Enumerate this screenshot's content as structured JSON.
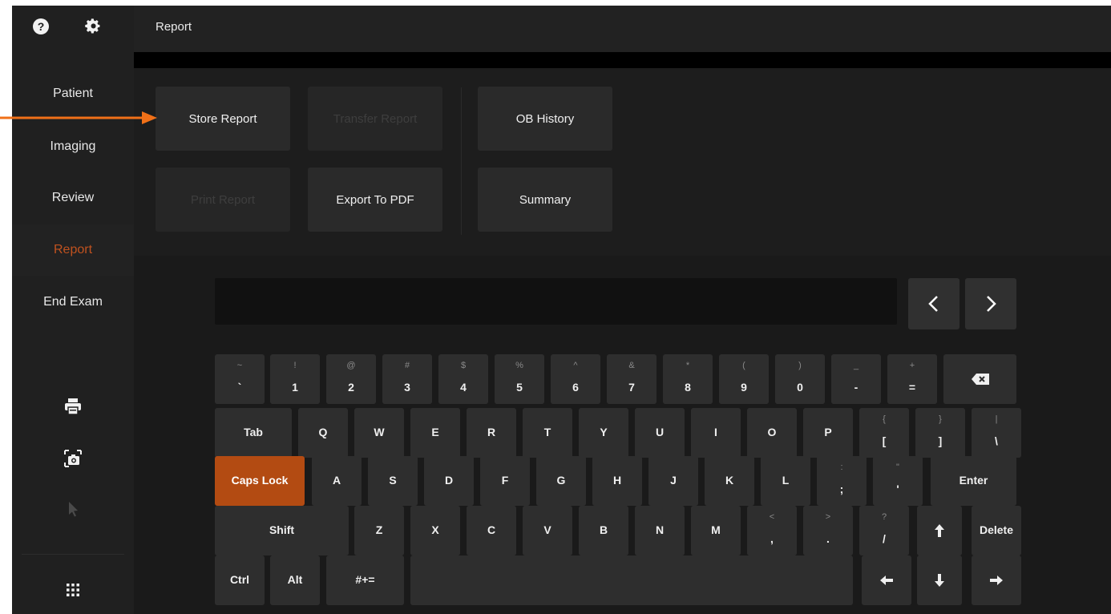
{
  "header": {
    "title": "Report"
  },
  "sidebar": {
    "items": [
      {
        "label": "Patient"
      },
      {
        "label": "Imaging"
      },
      {
        "label": "Review"
      },
      {
        "label": "Report",
        "active": true
      },
      {
        "label": "End Exam"
      }
    ],
    "icons": [
      "help-icon",
      "gear-icon",
      "print-icon",
      "camera-icon",
      "pointer-icon",
      "apps-grid-icon"
    ]
  },
  "report_buttons": {
    "store": "Store Report",
    "transfer": "Transfer Report",
    "ob_history": "OB History",
    "print": "Print Report",
    "export_pdf": "Export To PDF",
    "summary": "Summary"
  },
  "keyboard": {
    "row1": [
      {
        "shift": "~",
        "base": "`"
      },
      {
        "shift": "!",
        "base": "1"
      },
      {
        "shift": "@",
        "base": "2"
      },
      {
        "shift": "#",
        "base": "3"
      },
      {
        "shift": "$",
        "base": "4"
      },
      {
        "shift": "%",
        "base": "5"
      },
      {
        "shift": "^",
        "base": "6"
      },
      {
        "shift": "&",
        "base": "7"
      },
      {
        "shift": "*",
        "base": "8"
      },
      {
        "shift": "(",
        "base": "9"
      },
      {
        "shift": ")",
        "base": "0"
      },
      {
        "shift": "_",
        "base": "-"
      },
      {
        "shift": "+",
        "base": "="
      }
    ],
    "tab": "Tab",
    "row2": [
      "Q",
      "W",
      "E",
      "R",
      "T",
      "Y",
      "U",
      "I",
      "O",
      "P"
    ],
    "row2_sym": [
      {
        "shift": "{",
        "base": "["
      },
      {
        "shift": "}",
        "base": "]"
      },
      {
        "shift": "|",
        "base": "\\"
      }
    ],
    "caps": "Caps Lock",
    "row3": [
      "A",
      "S",
      "D",
      "F",
      "G",
      "H",
      "J",
      "K",
      "L"
    ],
    "row3_sym": [
      {
        "shift": ":",
        "base": ";"
      },
      {
        "shift": "\"",
        "base": "'"
      }
    ],
    "enter": "Enter",
    "shift": "Shift",
    "row4": [
      "Z",
      "X",
      "C",
      "V",
      "B",
      "N",
      "M"
    ],
    "row4_sym": [
      {
        "shift": "<",
        "base": ","
      },
      {
        "shift": ">",
        "base": "."
      },
      {
        "shift": "?",
        "base": "/"
      }
    ],
    "delete": "Delete",
    "ctrl": "Ctrl",
    "alt": "Alt",
    "symbols": "#+="
  },
  "colors": {
    "accent": "#b34b12",
    "active_nav": "#c0521f",
    "background": "#1b1b1b"
  }
}
